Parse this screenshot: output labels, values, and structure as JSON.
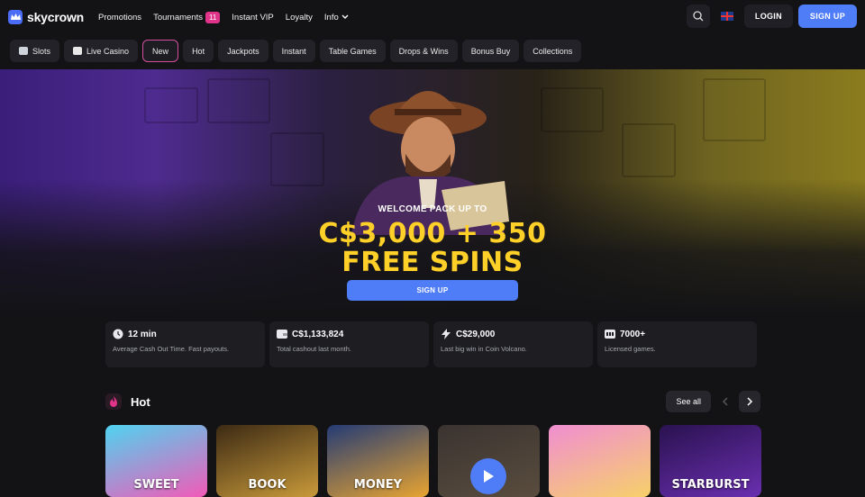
{
  "header": {
    "logo_text": "skycrown",
    "nav": [
      {
        "label": "Promotions"
      },
      {
        "label": "Tournaments",
        "badge": "11"
      },
      {
        "label": "Instant VIP"
      },
      {
        "label": "Loyalty"
      },
      {
        "label": "Info",
        "dropdown": true
      }
    ],
    "login_label": "LOGIN",
    "signup_label": "SIGN UP",
    "language_icon": "uk-flag-icon"
  },
  "categories": [
    "Slots",
    "Live Casino",
    "New",
    "Hot",
    "Jackpots",
    "Instant",
    "Table Games",
    "Drops & Wins",
    "Bonus Buy",
    "Collections"
  ],
  "active_category": "New",
  "hero": {
    "subtitle": "WELCOME PACK UP TO",
    "title_line1": "C$3,000 + 350",
    "title_line2": "FREE SPINS",
    "cta": "SIGN UP"
  },
  "stats": [
    {
      "value": "12 min",
      "caption": "Average Cash Out Time. Fast payouts.",
      "icon": "clock-icon"
    },
    {
      "value": "C$1,133,824",
      "caption": "Total cashout last month.",
      "icon": "wallet-icon"
    },
    {
      "value": "C$29,000",
      "caption": "Last big win in Coin Volcano.",
      "icon": "lightning-icon"
    },
    {
      "value": "7000+",
      "caption": "Licensed games.",
      "icon": "games-icon"
    }
  ],
  "section": {
    "title": "Hot",
    "see_all": "See all"
  },
  "games": [
    {
      "label": "SWEET",
      "colors": [
        "#4fd3f0",
        "#f25ab7"
      ]
    },
    {
      "label": "BOOK",
      "colors": [
        "#3c2a14",
        "#c99a3a"
      ]
    },
    {
      "label": "MONEY",
      "colors": [
        "#243b74",
        "#e8a431"
      ]
    },
    {
      "label": "",
      "colors": [
        "#3a3330",
        "#5a4d3e"
      ]
    },
    {
      "label": "",
      "colors": [
        "#f08ed1",
        "#f6d06a"
      ]
    },
    {
      "label": "STARBURST",
      "colors": [
        "#2a1250",
        "#6a2fb0"
      ]
    }
  ]
}
